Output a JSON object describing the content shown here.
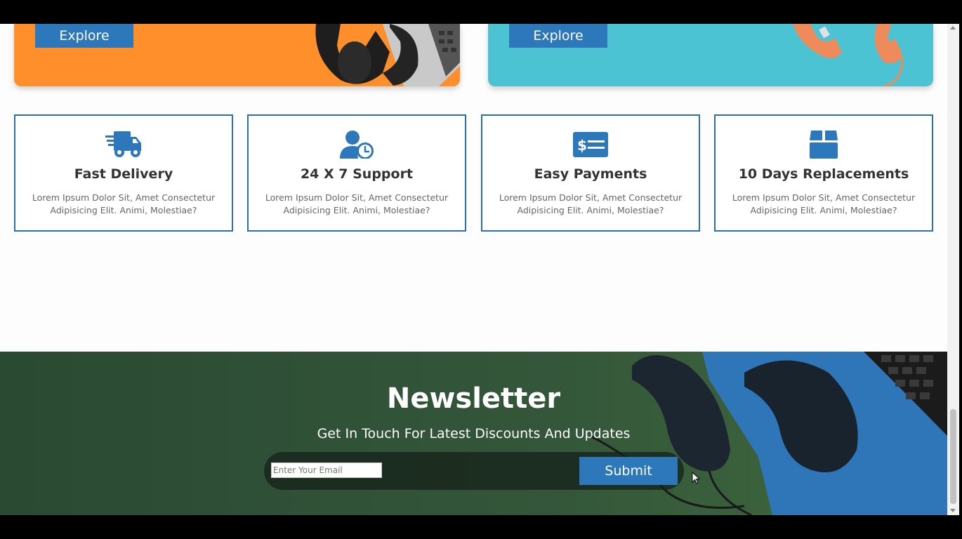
{
  "banners": [
    {
      "explore_label": "Explore"
    },
    {
      "explore_label": "Explore"
    }
  ],
  "features": [
    {
      "icon": "delivery-truck-icon",
      "title": "Fast Delivery",
      "text": "Lorem Ipsum Dolor Sit, Amet Consectetur Adipisicing Elit. Animi, Molestiae?"
    },
    {
      "icon": "user-clock-icon",
      "title": "24 X 7 Support",
      "text": "Lorem Ipsum Dolor Sit, Amet Consectetur Adipisicing Elit. Animi, Molestiae?"
    },
    {
      "icon": "money-check-icon",
      "title": "Easy Payments",
      "text": "Lorem Ipsum Dolor Sit, Amet Consectetur Adipisicing Elit. Animi, Molestiae?"
    },
    {
      "icon": "box-icon",
      "title": "10 Days Replacements",
      "text": "Lorem Ipsum Dolor Sit, Amet Consectetur Adipisicing Elit. Animi, Molestiae?"
    }
  ],
  "newsletter": {
    "title": "Newsletter",
    "subtitle": "Get In Touch For Latest Discounts And Updates",
    "email_placeholder": "Enter Your Email",
    "submit_label": "Submit"
  },
  "colors": {
    "accent": "#2d77bb",
    "feature_border": "#2d6fab",
    "banner_orange": "#fe8f2a",
    "banner_teal": "#4cc3d3",
    "newsletter_bg": "#2d4a34"
  }
}
